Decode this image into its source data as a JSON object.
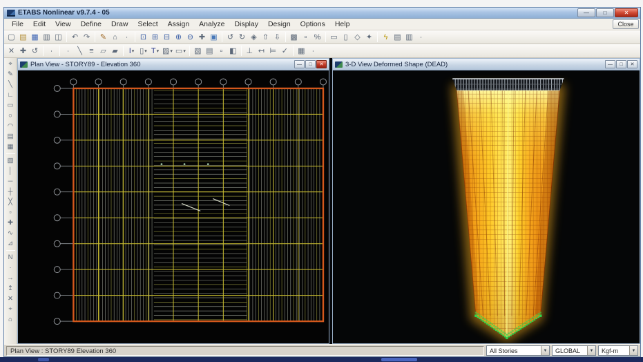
{
  "window": {
    "title": "ETABS Nonlinear v9.7.4 - 05",
    "close_button_label": "Close",
    "controls": {
      "minimize": "—",
      "maximize": "□",
      "close": "✕"
    }
  },
  "menu": {
    "items": [
      "File",
      "Edit",
      "View",
      "Define",
      "Draw",
      "Select",
      "Assign",
      "Analyze",
      "Display",
      "Design",
      "Options",
      "Help"
    ]
  },
  "toolbar_top": {
    "groups": [
      [
        {
          "name": "new-model-icon",
          "glyph": "▢"
        },
        {
          "name": "open-file-icon",
          "glyph": "▤",
          "color": "#b08a30"
        },
        {
          "name": "save-icon",
          "glyph": "▦",
          "color": "#3c64b4"
        },
        {
          "name": "print-icon",
          "glyph": "▥"
        },
        {
          "name": "print-preview-icon",
          "glyph": "◫"
        }
      ],
      [
        {
          "name": "undo-icon",
          "glyph": "↶"
        },
        {
          "name": "redo-icon",
          "glyph": "↷"
        }
      ],
      [
        {
          "name": "edit-icon",
          "glyph": "✎",
          "color": "#a06a28"
        },
        {
          "name": "lock-model-icon",
          "glyph": "⌂"
        },
        {
          "name": "more-dot-icon",
          "glyph": "∙"
        }
      ],
      [
        {
          "name": "zoom-window-icon",
          "glyph": "⊡",
          "color": "#3a5ea6"
        },
        {
          "name": "zoom-full-icon",
          "glyph": "⊞",
          "color": "#3a5ea6"
        },
        {
          "name": "zoom-previous-icon",
          "glyph": "⊟",
          "color": "#3a5ea6"
        },
        {
          "name": "zoom-in-icon",
          "glyph": "⊕",
          "color": "#3a5ea6"
        },
        {
          "name": "zoom-out-icon",
          "glyph": "⊖",
          "color": "#3a5ea6"
        },
        {
          "name": "pan-icon",
          "glyph": "✚"
        },
        {
          "name": "rubber-band-icon",
          "glyph": "▣",
          "color": "#4878b8"
        }
      ],
      [
        {
          "name": "rotate-3d-icon",
          "glyph": "↺"
        },
        {
          "name": "refresh-view-icon",
          "glyph": "↻"
        },
        {
          "name": "perspective-icon",
          "glyph": "◈"
        },
        {
          "name": "move-up-story-icon",
          "glyph": "⇧"
        },
        {
          "name": "move-down-story-icon",
          "glyph": "⇩"
        }
      ],
      [
        {
          "name": "show-grid-icon",
          "glyph": "▩"
        },
        {
          "name": "shrink-objects-icon",
          "glyph": "▫"
        },
        {
          "name": "percent-icon",
          "glyph": "%"
        }
      ],
      [
        {
          "name": "plan-view-button-icon",
          "glyph": "▭"
        },
        {
          "name": "elevation-view-icon",
          "glyph": "▯"
        },
        {
          "name": "three-d-view-icon",
          "glyph": "◇"
        },
        {
          "name": "named-view-icon",
          "glyph": "✦"
        }
      ],
      [
        {
          "name": "run-analysis-icon",
          "glyph": "ϟ",
          "color": "#b89400"
        },
        {
          "name": "show-tables-icon",
          "glyph": "▤"
        },
        {
          "name": "display-options-icon",
          "glyph": "▥"
        },
        {
          "name": "more-tools-dot-icon",
          "glyph": "∙"
        }
      ]
    ]
  },
  "toolbar_draw": {
    "groups": [
      [
        {
          "name": "select-pointer-icon",
          "glyph": "✕"
        },
        {
          "name": "select-poly-icon",
          "glyph": "✚"
        },
        {
          "name": "restore-selection-icon",
          "glyph": "↺"
        }
      ],
      [
        {
          "name": "clear-selection-dot-icon",
          "glyph": "∙"
        }
      ],
      [
        {
          "name": "draw-point-icon",
          "glyph": "∙"
        },
        {
          "name": "draw-line-icon",
          "glyph": "╲"
        },
        {
          "name": "quick-draw-line-icon",
          "glyph": "≡"
        },
        {
          "name": "draw-area-icon",
          "glyph": "▱"
        },
        {
          "name": "quick-draw-area-icon",
          "glyph": "▰"
        }
      ],
      [
        {
          "name": "beam-section-dropdown",
          "glyph": "I",
          "drop": true,
          "color": "#2a3a8c"
        },
        {
          "name": "column-section-dropdown",
          "glyph": "▯",
          "drop": true
        },
        {
          "name": "brace-section-dropdown",
          "glyph": "T",
          "drop": true,
          "color": "#2a3a8c"
        },
        {
          "name": "wall-section-dropdown",
          "glyph": "▨",
          "drop": true
        },
        {
          "name": "slab-section-dropdown",
          "glyph": "▭",
          "drop": true
        }
      ],
      [
        {
          "name": "view-options-icon",
          "glyph": "▧"
        },
        {
          "name": "object-fill-icon",
          "glyph": "▤"
        },
        {
          "name": "object-shrink-icon",
          "glyph": "▫"
        },
        {
          "name": "extrude-view-icon",
          "glyph": "◧"
        }
      ],
      [
        {
          "name": "snap-grid-icon",
          "glyph": "⊥"
        },
        {
          "name": "snap-point-icon",
          "glyph": "↤"
        },
        {
          "name": "snap-line-icon",
          "glyph": "⊨"
        },
        {
          "name": "snap-check-icon",
          "glyph": "✓"
        }
      ],
      [
        {
          "name": "drawing-settings-icon",
          "glyph": "▦"
        },
        {
          "name": "draw-more-dot-icon",
          "glyph": "∙"
        }
      ]
    ]
  },
  "side_toolbar": {
    "groups": [
      [
        {
          "name": "pointer-tool-icon",
          "glyph": "⌖"
        },
        {
          "name": "edit-tool-icon",
          "glyph": "✎"
        },
        {
          "name": "line-tool-icon",
          "glyph": "╲"
        },
        {
          "name": "polyline-tool-icon",
          "glyph": "∟"
        },
        {
          "name": "rectangle-tool-icon",
          "glyph": "▭"
        },
        {
          "name": "circle-tool-icon",
          "glyph": "○"
        },
        {
          "name": "arc-tool-icon",
          "glyph": "◠"
        },
        {
          "name": "grid-tool-icon",
          "glyph": "▤"
        },
        {
          "name": "mesh-tool-icon",
          "glyph": "▦"
        }
      ],
      [
        {
          "name": "area-tool-icon",
          "glyph": "▧"
        },
        {
          "name": "column-tool-icon",
          "glyph": "│"
        },
        {
          "name": "beam-tool-icon",
          "glyph": "─"
        },
        {
          "name": "intersect-tool-icon",
          "glyph": "┼"
        },
        {
          "name": "brace-tool-icon",
          "glyph": "╳"
        },
        {
          "name": "point-tool-icon",
          "glyph": "▫"
        },
        {
          "name": "axes-tool-icon",
          "glyph": "✚"
        },
        {
          "name": "spline-tool-icon",
          "glyph": "∿"
        },
        {
          "name": "triangle-tool-icon",
          "glyph": "⊿"
        }
      ],
      [
        {
          "name": "north-tool-icon",
          "glyph": "N"
        },
        {
          "name": "dot-tool-icon",
          "glyph": "∙"
        },
        {
          "name": "arrow-right-tool-icon",
          "glyph": "→"
        },
        {
          "name": "arrow-up-tool-icon",
          "glyph": "↥"
        },
        {
          "name": "delete-tool-icon",
          "glyph": "✕"
        },
        {
          "name": "plus-tool-icon",
          "glyph": "+"
        },
        {
          "name": "home-tool-icon",
          "glyph": "⌂"
        }
      ]
    ]
  },
  "panels": {
    "plan": {
      "title": "Plan View - STORY89 - Elevation 360"
    },
    "view3d": {
      "title": "3-D View  Deformed Shape (DEAD)"
    }
  },
  "status_bar": {
    "text": "Plan View : STORY89  Elevation 360",
    "dropdowns": [
      {
        "name": "stories-dropdown",
        "value": "All Stories"
      },
      {
        "name": "coord-system-dropdown",
        "value": "GLOBAL"
      },
      {
        "name": "units-dropdown",
        "value": "Kgf-m"
      }
    ],
    "arrow_glyph": "▼"
  },
  "colors": {
    "titlebar_blue": "#a9c4e4",
    "plan_border_orange": "#d4581c",
    "grid_major_yellow": "#c9bd30",
    "mesh_gray": "#8f9389",
    "mesh_olive": "#9a9a40",
    "bubble_gray": "#8f9398",
    "tower_orange": "#f09a16",
    "tower_yellow": "#ffe85c",
    "support_green": "#2fd84e",
    "cap_gray": "#aab2ba",
    "status_bg": "#d8d4cb"
  },
  "plan_view": {
    "top_bubbles": 11,
    "left_bubbles": 10,
    "regions": [
      {
        "o": "v",
        "a": 84,
        "b": 196,
        "s": 4.2
      },
      {
        "o": "h",
        "a": 196,
        "b": 330,
        "s": 6.4
      },
      {
        "o": "v",
        "a": 330,
        "b": 437,
        "s": 4.2
      }
    ]
  },
  "view_3d": {
    "edge_dots_per_side": 17,
    "column_lines": 9
  }
}
